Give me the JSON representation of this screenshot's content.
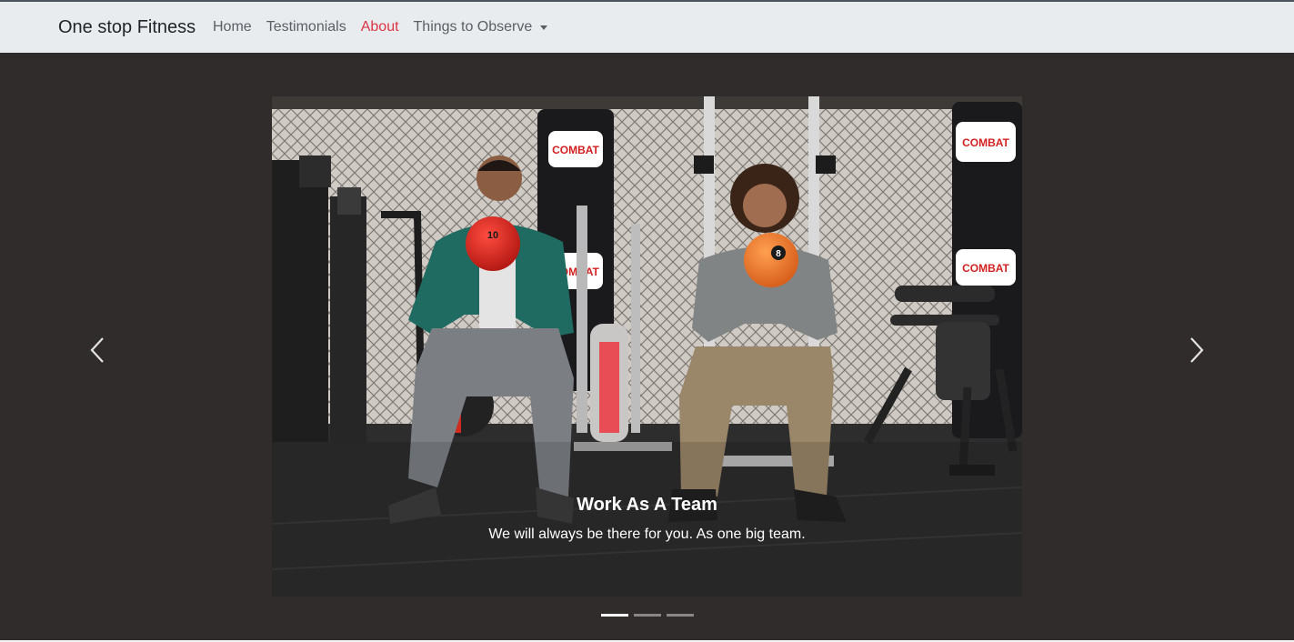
{
  "nav": {
    "brand": "One stop Fitness",
    "links": [
      {
        "label": "Home",
        "active": false
      },
      {
        "label": "Testimonials",
        "active": false
      },
      {
        "label": "About",
        "active": true
      },
      {
        "label": "Things to Observe",
        "active": false,
        "dropdown": true
      }
    ]
  },
  "carousel": {
    "slide": {
      "title": "Work As A Team",
      "text": "We will always be there for you. As one big team.",
      "image_description": "Two people doing squats while holding medicine balls in a gym"
    },
    "ball_numbers": [
      "10",
      "8"
    ],
    "banner_text": "COMBAT",
    "prev_icon": "chevron-left-icon",
    "next_icon": "chevron-right-icon",
    "indicators": [
      {
        "active": true
      },
      {
        "active": false
      },
      {
        "active": false
      }
    ],
    "active_index": 0,
    "slide_count": 3
  },
  "colors": {
    "navbar_bg": "#e9ecef",
    "active_link": "#dc3545",
    "stage_bg": "#302c2c"
  }
}
